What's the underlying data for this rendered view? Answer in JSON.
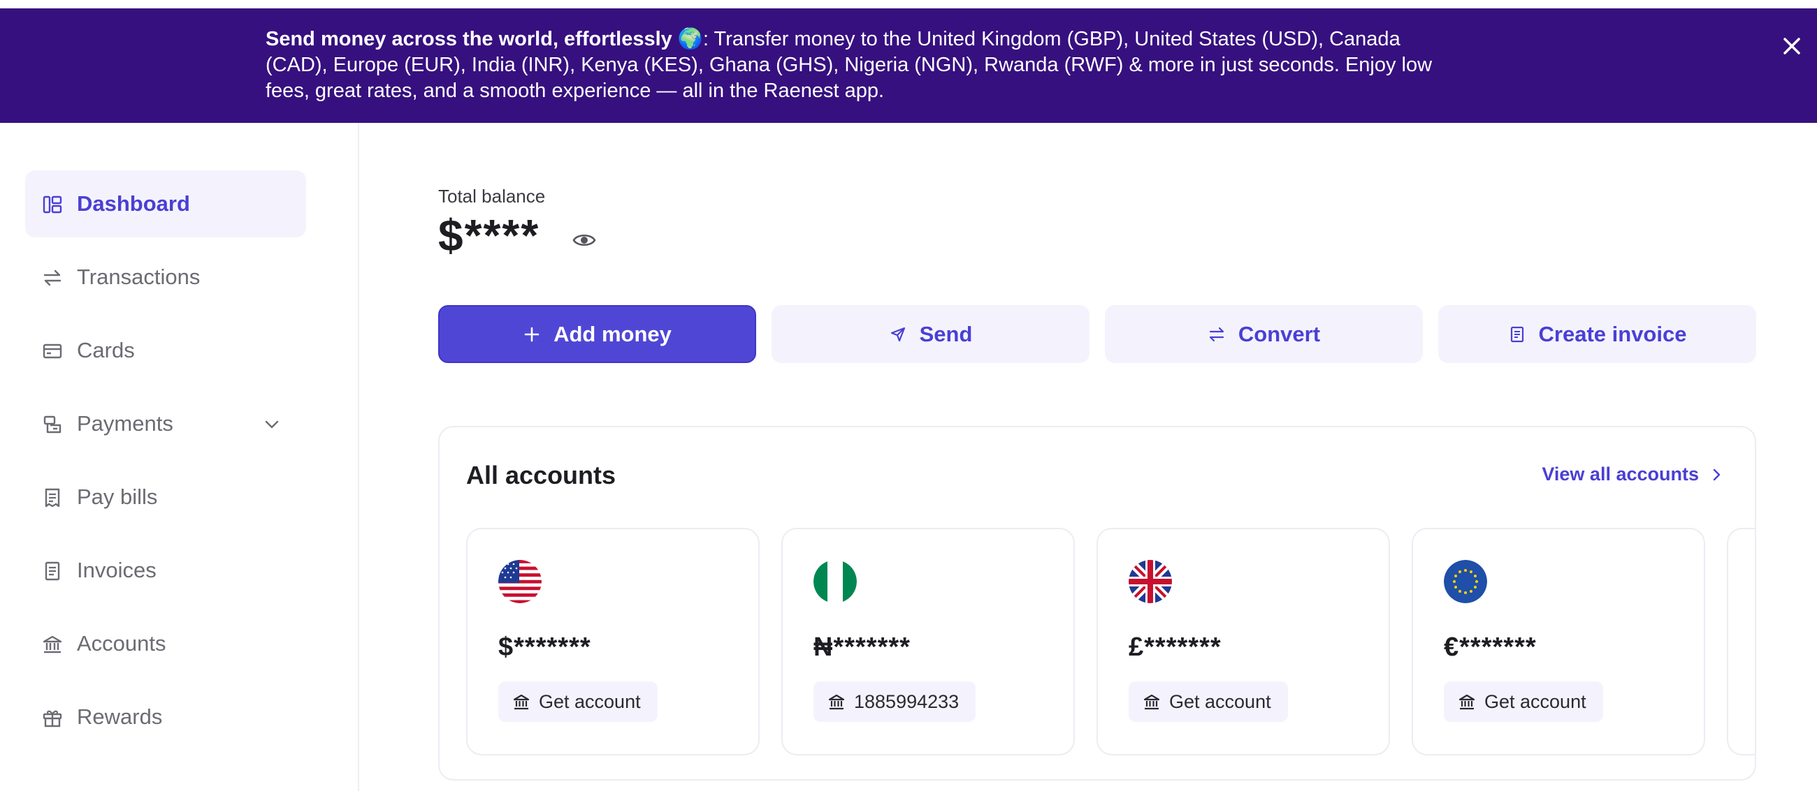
{
  "banner": {
    "headline": "Send money across the world, effortlessly",
    "emoji": "🌍",
    "body": ": Transfer money to the United Kingdom (GBP), United States (USD), Canada (CAD), Europe (EUR), India (INR), Kenya (KES), Ghana (GHS), Nigeria (NGN), Rwanda (RWF) & more in just seconds. Enjoy low fees, great rates, and a smooth experience — all in the Raenest app.",
    "close_icon": "close-icon",
    "background": "#36107f"
  },
  "sidebar": {
    "items": [
      {
        "label": "Dashboard",
        "icon": "dashboard-icon",
        "active": true
      },
      {
        "label": "Transactions",
        "icon": "transactions-icon"
      },
      {
        "label": "Cards",
        "icon": "card-icon"
      },
      {
        "label": "Payments",
        "icon": "payments-icon",
        "has_submenu": true
      },
      {
        "label": "Pay bills",
        "icon": "bill-icon"
      },
      {
        "label": "Invoices",
        "icon": "invoice-icon"
      },
      {
        "label": "Accounts",
        "icon": "bank-icon"
      },
      {
        "label": "Rewards",
        "icon": "gift-icon"
      }
    ]
  },
  "balance": {
    "label": "Total balance",
    "value": "$****",
    "visibility_icon": "eye-icon"
  },
  "actions": {
    "add_money": "Add money",
    "send": "Send",
    "convert": "Convert",
    "create_invoice": "Create invoice"
  },
  "accounts": {
    "title": "All accounts",
    "view_all": "View all accounts",
    "cards": [
      {
        "flag": "us-flag-icon",
        "balance": "$*******",
        "chip": "Get account"
      },
      {
        "flag": "ng-flag-icon",
        "balance": "₦*******",
        "chip": "1885994233"
      },
      {
        "flag": "uk-flag-icon",
        "balance": "£*******",
        "chip": "Get account"
      },
      {
        "flag": "eu-flag-icon",
        "balance": "€*******",
        "chip": "Get account"
      }
    ]
  },
  "colors": {
    "accent": "#4a3fd4",
    "primary_button": "#5046d6",
    "soft_bg": "#f4f3fd"
  }
}
